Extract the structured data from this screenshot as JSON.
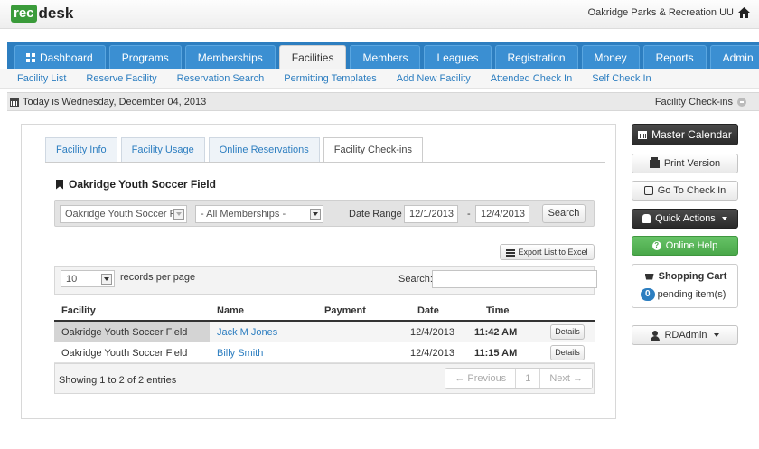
{
  "header": {
    "logo_rec": "rec",
    "logo_desk": "desk",
    "org": "Oakridge Parks & Recreation UU"
  },
  "nav": {
    "tabs": [
      {
        "label": "Dashboard"
      },
      {
        "label": "Programs"
      },
      {
        "label": "Memberships"
      },
      {
        "label": "Facilities"
      },
      {
        "label": "Members"
      },
      {
        "label": "Leagues"
      },
      {
        "label": "Registration"
      },
      {
        "label": "Money"
      },
      {
        "label": "Reports"
      },
      {
        "label": "Admin"
      }
    ],
    "active": "Facilities"
  },
  "subnav": {
    "links": [
      "Facility List",
      "Reserve Facility",
      "Reservation Search",
      "Permitting Templates",
      "Add New Facility",
      "Attended Check In",
      "Self Check In"
    ]
  },
  "datebar": {
    "today": "Today is Wednesday, December 04, 2013",
    "right": "Facility Check-ins"
  },
  "panel": {
    "tabs": [
      "Facility Info",
      "Facility Usage",
      "Online Reservations",
      "Facility Check-ins"
    ],
    "title": "Oakridge Youth Soccer Field",
    "filters": {
      "facility": "Oakridge Youth Soccer F",
      "membership": "- All Memberships -",
      "date_range_label": "Date Range",
      "start": "12/1/2013",
      "dash": "-",
      "end": "12/4/2013",
      "search_btn": "Search"
    },
    "export_btn": "Export List to Excel",
    "per_page": {
      "value": "10",
      "label": "records per page"
    },
    "search_label": "Search:",
    "columns": [
      "Facility",
      "Name",
      "Payment",
      "Date",
      "Time"
    ],
    "rows": [
      {
        "facility": "Oakridge Youth Soccer Field",
        "name": "Jack M Jones",
        "payment": "",
        "date": "12/4/2013",
        "time": "11:42 AM",
        "action": "Details"
      },
      {
        "facility": "Oakridge Youth Soccer Field",
        "name": "Billy Smith",
        "payment": "",
        "date": "12/4/2013",
        "time": "11:15 AM",
        "action": "Details"
      }
    ],
    "showing": "Showing 1 to 2 of 2 entries",
    "pager": {
      "prev": "← Previous",
      "page": "1",
      "next": "Next →"
    }
  },
  "sidebar": {
    "master_calendar": "Master Calendar",
    "print": "Print Version",
    "checkin": "Go To Check In",
    "quick_actions": "Quick Actions",
    "help": "Online Help",
    "cart_title": "Shopping Cart",
    "cart_count": "0",
    "cart_text": "pending item(s)",
    "user": "RDAdmin"
  },
  "colors": {
    "nav_blue": "#2d7ec0",
    "green": "#3a9b3a",
    "dark": "#2a2a2a"
  }
}
